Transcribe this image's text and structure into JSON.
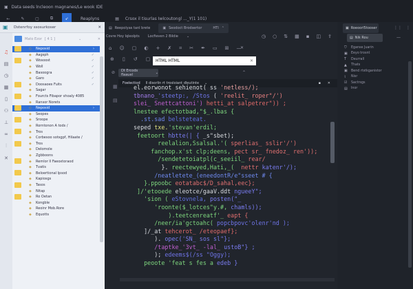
{
  "window": {
    "title": "Data seeds lncleoon magnanes/Le wook IDE"
  },
  "toolbar": {
    "items": [
      "back-icon",
      "edit-icon",
      "window-icon",
      "crop-icon",
      "rocket-icon"
    ],
    "active_label": "Reaplyns",
    "path": "Crsox il tisurlas Iwlcoutongl ..._Y(1 101)"
  },
  "left_panel": {
    "title": "Dstenrfoy ssosurkoser",
    "search_placeholder": "Mato Ezor",
    "search_hint": "[ 4 1 ]",
    "items": [
      {
        "label": "Neposid",
        "selected": true,
        "folder": true
      },
      {
        "label": "Aagsph",
        "check": true
      },
      {
        "label": "Wosoost",
        "check": true,
        "folder": true
      },
      {
        "label": "Woll",
        "check": true
      },
      {
        "label": "Basoogra",
        "check": true
      },
      {
        "label": "Garo",
        "check": true
      },
      {
        "label": "Doosaoes Fuits",
        "check": true,
        "folder": true
      },
      {
        "label": "Sagar"
      },
      {
        "label": "Fourcts Fibapor shoaly 4085",
        "folder": true
      },
      {
        "label": "Ransor Norets"
      },
      {
        "label": "Neposid",
        "selected": true,
        "folder": true
      },
      {
        "label": "Seopes"
      },
      {
        "label": "Sroope",
        "folder": true
      },
      {
        "label": "Rorntonon A tods /"
      },
      {
        "label": "Tros",
        "folder": true
      },
      {
        "label": "Corbesoo sotsgpf, Hilaate /"
      },
      {
        "label": "Tros",
        "folder": true
      },
      {
        "label": "Delomole"
      },
      {
        "label": "Zgbboons"
      },
      {
        "label": "Remlor II Faeoxtoraod",
        "folder": true
      },
      {
        "label": "Tvatis"
      },
      {
        "label": "Beloertional Ipsod",
        "folder": true
      },
      {
        "label": "Kapiosgs"
      },
      {
        "label": "Tasos",
        "folder": true
      },
      {
        "label": "Nitap"
      },
      {
        "label": "Ro Oetan",
        "folder": true
      },
      {
        "label": "Kongble"
      },
      {
        "label": "Reoinr Mob.Rore"
      },
      {
        "label": "Equotts"
      }
    ]
  },
  "editor": {
    "tabs": [
      {
        "label": "Reepolyas tanl brete",
        "active": false
      },
      {
        "label": "Seodoct Brodsertor",
        "active": true,
        "extra": "HTI"
      }
    ],
    "breadcrumb": [
      "Covre Hoy Iqleolpts",
      "Locfieven 2 Bildie"
    ],
    "search_value": "HTML HTML",
    "filter_label": "Dt Ercods flaauel",
    "results_label": "Foelectiod",
    "results_detail": "Il disorlin rt trosloiant dleutinte",
    "code": [
      [
        [
          "el.eorwonot sehienot( ss ",
          "#d8dbe0"
        ],
        [
          "'netless/);",
          "#e8a0a0"
        ]
      ],
      [
        [
          "tbnano_",
          "#a07ce8"
        ],
        [
          "'steetp:, /Stos ",
          "#6f74e8"
        ],
        [
          "( ",
          "#d8dbe0"
        ],
        [
          "'reelit_ roper\"/')",
          "#e88080"
        ]
      ],
      [
        [
          "slei_ Snettcattoni') ",
          "#c060d0"
        ],
        [
          "hetti_at salpetrer\")) ;",
          "#e06a6a"
        ]
      ],
      [
        [
          "lnestee efectotbad,\"$_.lbas {",
          "#7ed67e"
        ]
      ],
      [
        [
          "  .st.sad ",
          "#6f8af0"
        ],
        [
          "belsteteat.",
          "#6070e0"
        ]
      ],
      [
        [
          "seped ",
          "#d8dbe0"
        ],
        [
          "txe.",
          "#e0e080"
        ],
        [
          "'stevan'erdil;",
          "#7ed67e"
        ]
      ],
      [
        [
          " feetoort ",
          "#7ed67e"
        ],
        [
          "hbtte(| { ",
          "#7a7cf0"
        ],
        [
          "_s\"sbet);",
          "#d8dbe0"
        ]
      ],
      [
        [
          "       reelalion,Ssalsal.'( ",
          "#7ed67e"
        ],
        [
          "sperlias_ sslir'/')",
          "#e07070"
        ]
      ],
      [
        [
          "     fanchop.x'st clp;deens, ",
          "#7ed67e"
        ],
        [
          "pect sr_ fnedoz_ ren'));",
          "#e07070"
        ]
      ],
      [
        [
          "       /sendetetoiatpl(c_seeiil_ ",
          "#7ed67e"
        ],
        [
          "rear/",
          "#e07070"
        ]
      ],
      [
        [
          "        }. ",
          "#d8dbe0"
        ],
        [
          "reectewyed,Hati,_(  ",
          "#7ed67e"
        ],
        [
          "nettr ",
          "#e07070"
        ],
        [
          "katenr'/);",
          "#7a7cf0"
        ]
      ],
      [
        [
          "      /neatletete_(eneedontR/e\"sseet # {",
          "#6f8af0"
        ]
      ],
      [
        [
          "   }.ppoobc ",
          "#7ed67e"
        ],
        [
          "eotatabc$/D_sahal,eec};",
          "#e07070"
        ]
      ],
      [
        [
          " ]/'etooede ",
          "#7ed67e"
        ],
        [
          "eleotce/gaaV.ddt ",
          "#d8dbe0"
        ],
        [
          "ngueeY\";",
          "#7a7cf0"
        ]
      ],
      [
        [
          "   'sion ( ",
          "#7ed67e"
        ],
        [
          "eStovnela, ",
          "#6070e0"
        ],
        [
          "posten(\"_",
          "#7a7cf0"
        ]
      ],
      [
        [
          "      'roonte($_lotces\"y.#, ",
          "#7ed67e"
        ],
        [
          "chamls));",
          "#7a7cf0"
        ]
      ],
      [
        [
          "          ).teetcenreatf'_ ",
          "#7ed67e"
        ],
        [
          "eapt {",
          "#e07070"
        ]
      ],
      [
        [
          "      /neer/ia'gctoahc( ",
          "#7ed67e"
        ],
        [
          "popcbpovc'olenr'nd );",
          "#6f74e8"
        ]
      ],
      [
        [
          "   ]/_at ",
          "#d8dbe0"
        ],
        [
          "tehcerot_ /eteopaef};",
          "#e06a6a"
        ]
      ],
      [
        [
          "      ). ",
          "#d8dbe0"
        ],
        [
          "opec('SN_ sos sl\"};",
          "#7a7cf0"
        ]
      ],
      [
        [
          "      /taptke_'3vt_ -lal_ ",
          "#c060d0"
        ],
        [
          "ustoB\"} ;",
          "#7a7cf0"
        ]
      ],
      [
        [
          "      ); ",
          "#d8dbe0"
        ],
        [
          "edeems$(/ss \"Oggy);",
          "#6f74e8"
        ]
      ],
      [
        [
          "   peoote 'feat s fes a ",
          "#7ed67e"
        ],
        [
          "edeb }",
          "#7a7cf0"
        ]
      ]
    ]
  },
  "right_panel": {
    "tab": "Roeoorl5tooser",
    "dropdown": "Nik Rou",
    "items": [
      {
        "icon": "shield-icon",
        "label": "Eganse Juarin"
      },
      {
        "icon": "image-icon",
        "label": "Eeyo trosnt"
      },
      {
        "icon": "text-icon",
        "label": "Deurrall"
      },
      {
        "icon": "chart-icon",
        "label": "Thats"
      },
      {
        "icon": "image-icon",
        "label": "Bend rtstkganistor"
      },
      {
        "icon": "path-icon",
        "label": "Nisr"
      },
      {
        "icon": "check-icon",
        "label": "Sactrsgs"
      },
      {
        "icon": "file-icon",
        "label": "Inor"
      }
    ]
  }
}
